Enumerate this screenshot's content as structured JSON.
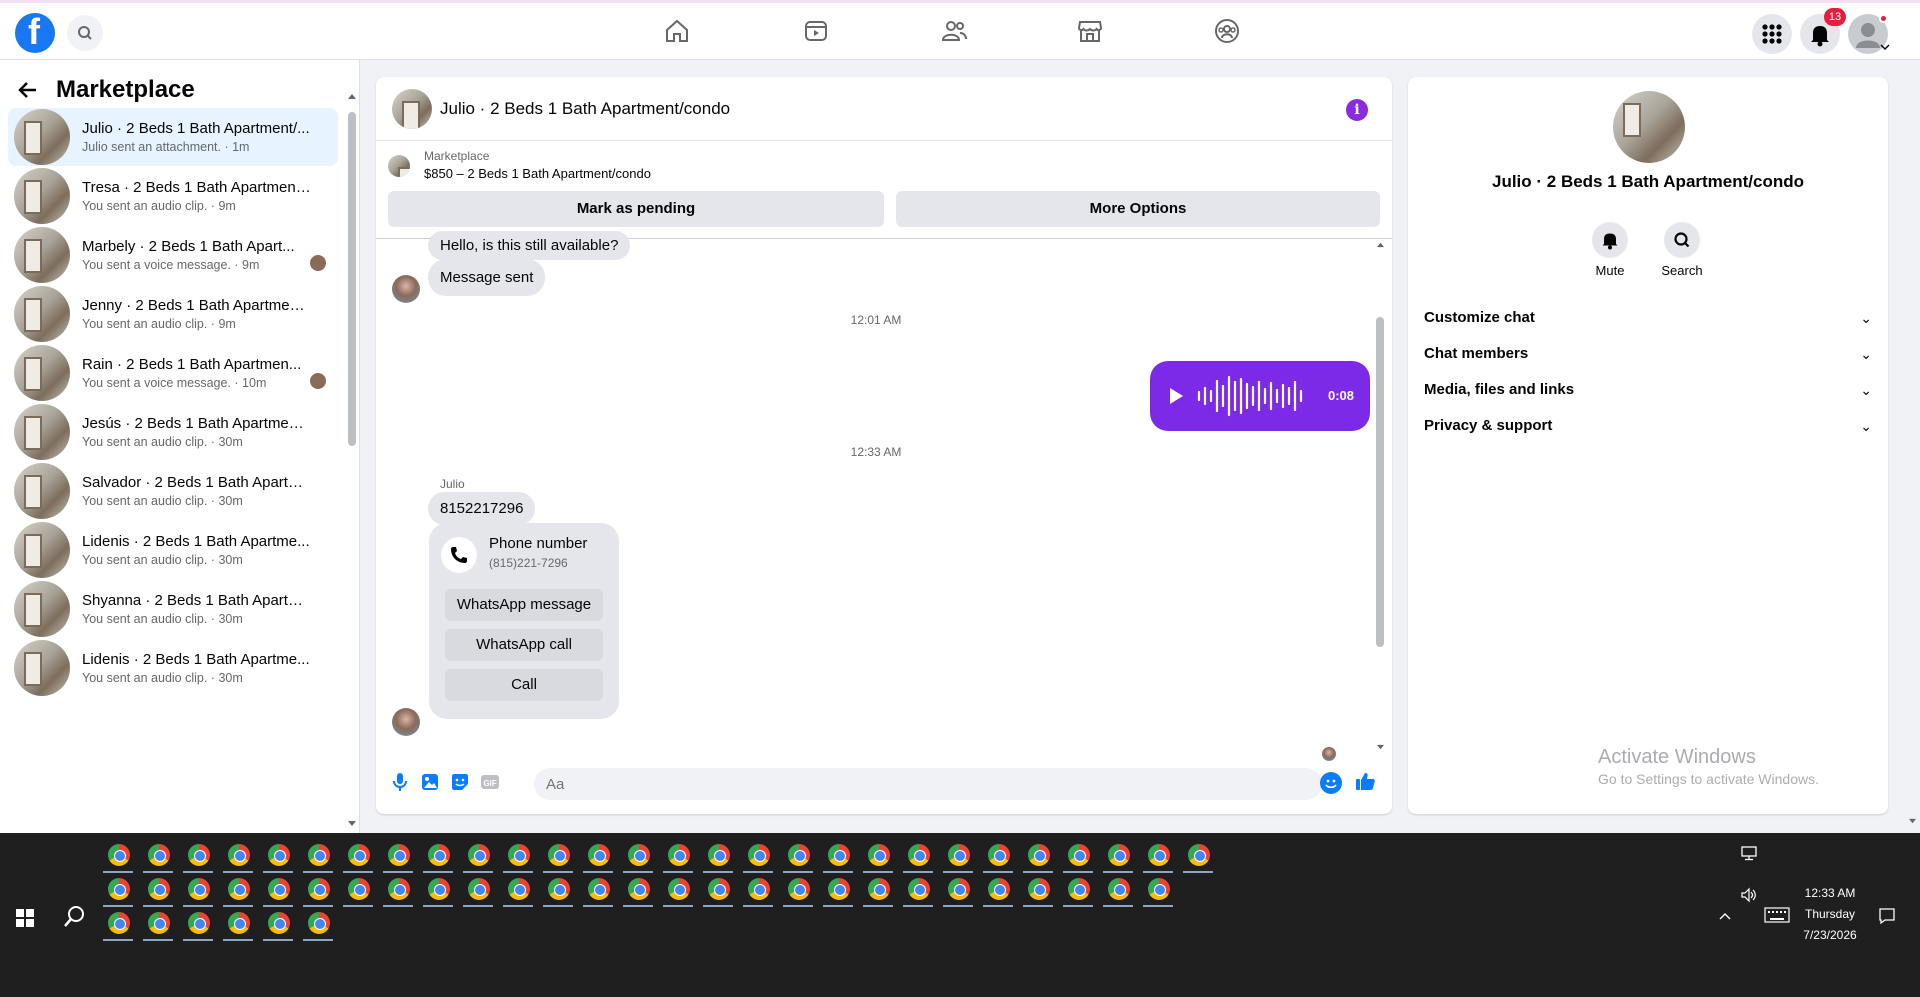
{
  "app": {
    "logo": "facebook-logo",
    "logo_letter": "f"
  },
  "nav": {
    "icons": [
      "home-icon",
      "video-icon",
      "friends-icon",
      "marketplace-icon",
      "groups-icon"
    ],
    "notification_count": "13"
  },
  "sidebar": {
    "title": "Marketplace",
    "conversations": [
      {
        "name": "Julio · 2 Beds 1 Bath Apartment/...",
        "sub": "Julio sent an attachment. · 1m",
        "active": true
      },
      {
        "name": "Tresa · 2 Beds 1 Bath Apartment...",
        "sub": "You sent an audio clip. · 9m"
      },
      {
        "name": "Marbely · 2 Beds 1 Bath Apart...",
        "sub": "You sent a voice message. · 9m",
        "seen": true
      },
      {
        "name": "Jenny · 2 Beds 1 Bath Apartment...",
        "sub": "You sent an audio clip. · 9m"
      },
      {
        "name": "Rain · 2 Beds 1 Bath Apartmen...",
        "sub": "You sent a voice message. · 10m",
        "seen": true
      },
      {
        "name": "Jesús · 2 Beds 1 Bath Apartment...",
        "sub": "You sent an audio clip. · 30m"
      },
      {
        "name": "Salvador · 2 Beds 1 Bath Apartm...",
        "sub": "You sent an audio clip. · 30m"
      },
      {
        "name": "Lidenis · 2 Beds 1 Bath Apartme...",
        "sub": "You sent an audio clip. · 30m"
      },
      {
        "name": "Shyanna · 2 Beds 1 Bath Apartm...",
        "sub": "You sent an audio clip. · 30m"
      },
      {
        "name": "Lidenis · 2 Beds 1 Bath Apartme...",
        "sub": "You sent an audio clip. · 30m"
      }
    ]
  },
  "chat": {
    "title": "Julio · 2 Beds 1 Bath Apartment/condo",
    "marketplace_label": "Marketplace",
    "listing": "$850 – 2 Beds 1 Bath Apartment/condo",
    "mark_pending": "Mark as pending",
    "more_options": "More Options",
    "messages": {
      "msg1": "Hello, is this still available?",
      "msg2": "Message sent",
      "ts1": "12:01 AM",
      "voice_duration": "0:08",
      "ts2": "12:33 AM",
      "sender": "Julio",
      "phone_msg": "8152217296",
      "card_title": "Phone number",
      "card_sub": "(815)221-7296",
      "whatsapp_message": "WhatsApp message",
      "whatsapp_call": "WhatsApp call",
      "call": "Call"
    },
    "composer_placeholder": "Aa"
  },
  "info": {
    "name": "Julio · 2 Beds 1 Bath Apartment/condo",
    "mute": "Mute",
    "search": "Search",
    "rows": [
      "Customize chat",
      "Chat members",
      "Media, files and links",
      "Privacy & support"
    ]
  },
  "watermark": {
    "line1": "Activate Windows",
    "line2": "Go to Settings to activate Windows."
  },
  "taskbar": {
    "time": "12:33 AM",
    "day": "Thursday",
    "date": "7/23/2026"
  }
}
